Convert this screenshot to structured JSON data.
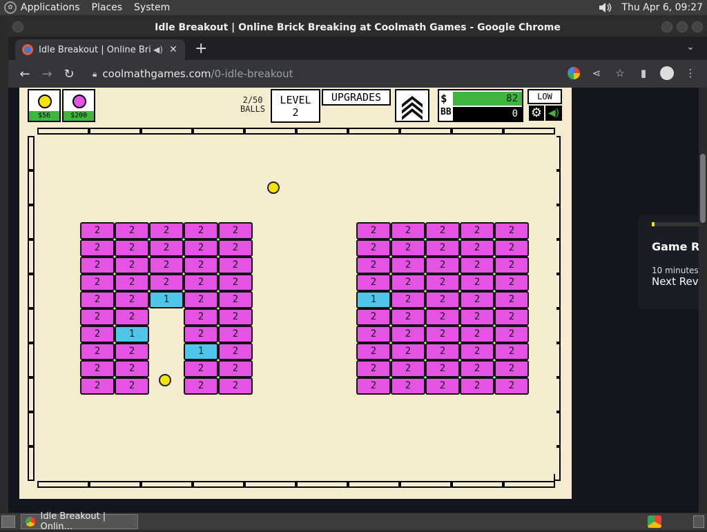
{
  "top_panel": {
    "menus": [
      "Applications",
      "Places",
      "System"
    ],
    "clock": "Thu Apr  6, 09:27"
  },
  "window": {
    "title": "Idle Breakout | Online Brick Breaking at Coolmath Games - Google Chrome"
  },
  "tab": {
    "title": "Idle Breakout | Online Bric",
    "new_tab_label": "+"
  },
  "address_bar": {
    "host": "coolmathgames.com",
    "path": "/0-idle-breakout"
  },
  "game": {
    "ball_shop": [
      {
        "price": "$56",
        "color": "#f5e400"
      },
      {
        "price": "$200",
        "color": "#e553e5"
      }
    ],
    "balls_count_line1": "2/50",
    "balls_count_line2": "BALLS",
    "level_label": "LEVEL",
    "level_value": "2",
    "upgrades_label": "UPGRADES",
    "money_label": "$",
    "money_value": "82",
    "bb_label": "BB",
    "bb_value": "0",
    "quality_label": "LOW",
    "brick_colors": {
      "hp2": "#e553e5",
      "hp1": "#4fc5ea"
    },
    "bricks": {
      "left_group": [
        [
          "2",
          "2",
          "2",
          "2",
          "2"
        ],
        [
          "2",
          "2",
          "2",
          "2",
          "2"
        ],
        [
          "2",
          "2",
          "2",
          "2",
          "2"
        ],
        [
          "2",
          "2",
          "2",
          "2",
          "2"
        ],
        [
          "2",
          "2",
          "1",
          "2",
          "2"
        ],
        [
          "2",
          "2",
          "",
          "2",
          "2"
        ],
        [
          "2",
          "1",
          "",
          "2",
          "2"
        ],
        [
          "2",
          "2",
          "",
          "1",
          "2"
        ],
        [
          "2",
          "2",
          "",
          "2",
          "2"
        ],
        [
          "2",
          "2",
          "",
          "2",
          "2"
        ]
      ],
      "right_group": [
        [
          "2",
          "2",
          "2",
          "2",
          "2"
        ],
        [
          "2",
          "2",
          "2",
          "2",
          "2"
        ],
        [
          "2",
          "2",
          "2",
          "2",
          "2"
        ],
        [
          "2",
          "2",
          "2",
          "2",
          "2"
        ],
        [
          "1",
          "2",
          "2",
          "2",
          "2"
        ],
        [
          "2",
          "2",
          "2",
          "2",
          "2"
        ],
        [
          "2",
          "2",
          "2",
          "2",
          "2"
        ],
        [
          "2",
          "2",
          "2",
          "2",
          "2"
        ],
        [
          "2",
          "2",
          "2",
          "2",
          "2"
        ],
        [
          "2",
          "2",
          "2",
          "2",
          "2"
        ]
      ]
    }
  },
  "side_card": {
    "title": "Game R",
    "subtitle": "10 minutes",
    "next": "Next Rev"
  },
  "taskbar": {
    "item_title": "Idle Breakout | Onlin..."
  }
}
